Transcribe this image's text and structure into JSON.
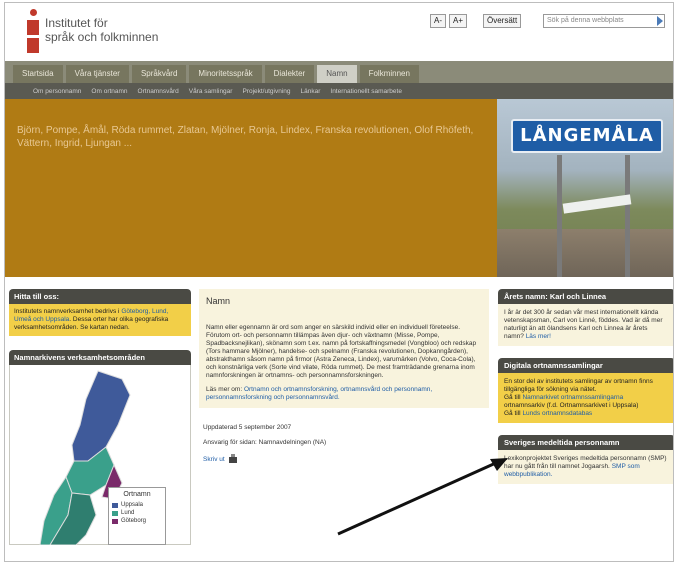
{
  "header": {
    "logo_line1": "Institutet för",
    "logo_line2": "språk och folkminnen",
    "font_smaller": "A-",
    "font_larger": "A+",
    "translate": "Översätt",
    "search_placeholder": "Sök på denna webbplats"
  },
  "main_nav": [
    {
      "label": "Startsida"
    },
    {
      "label": "Våra tjänster"
    },
    {
      "label": "Språkvård"
    },
    {
      "label": "Minoritetsspråk"
    },
    {
      "label": "Dialekter"
    },
    {
      "label": "Namn",
      "active": true
    },
    {
      "label": "Folkminnen"
    }
  ],
  "sub_nav": [
    {
      "label": "Om personnamn"
    },
    {
      "label": "Om ortnamn"
    },
    {
      "label": "Ortnamnsvård"
    },
    {
      "label": "Våra samlingar"
    },
    {
      "label": "Projekt/utgivning"
    },
    {
      "label": "Länkar"
    },
    {
      "label": "Internationellt samarbete"
    }
  ],
  "banner": {
    "text": "Björn, Pompe, Åmål, Röda rummet, Zlatan, Mjölner, Ronja, Lindex, Franska revolutionen, Olof Rhöfeth, Vättern, Ingrid, Ljungan ...",
    "sign_text": "LÅNGEMÅLA"
  },
  "left": {
    "find_title": "Hitta till oss:",
    "find_text": "Institutets namnverksamhet bedrivs i",
    "find_links": "Göteborg, Lund, Umeå och Uppsala",
    "find_text2": ". Dessa orter har olika geografiska verksamhetsområden. Se kartan nedan.",
    "map_title": "Namnarkivens verksamhetsområden",
    "legend_title": "Ortnamn",
    "legend": [
      {
        "label": "Uppsala",
        "color": "#3f5a9a"
      },
      {
        "label": "Lund",
        "color": "#3aa08b"
      },
      {
        "label": "Göteborg",
        "color": "#7a2a6a"
      }
    ]
  },
  "center": {
    "title": "Namn",
    "text": "Namn eller egennamn är ord som anger en särskild individ eller en individuell företeelse. Förutom ort- och personnamn tillämpas även djur- och växtnamn (Misse, Pompe, Spadbacksnejlikan), skönamn som t.ex. namn på fortskaffningsmedel (Vongbloo) och redskap (Tors hammare Mjölner), handelse- och spelnamn (Franska revolutionen, Dopkanngården), abstrakthamn såsom namn på firmor (Astra Zeneca, Lindex), varumärken (Volvo, Coca-Cola), och konstnärliga verk (Sorte vind vilate, Röda rummet). De mest framträdande grenarna inom namnforskningen är ortnamns- och personnamnsforskningen.",
    "read_more_prefix": "Läs mer om:",
    "read_more_links": "Ortnamn och ortnamnsforskning, ortnamnsvård och personnamn, personnamnsforskning och personnamnsvård.",
    "updated": "Uppdaterad 5 september 2007",
    "responsible": "Ansvarig för sidan: Namnavdelningen (NA)",
    "print": "Skriv ut"
  },
  "right": {
    "panel1_title": "Årets namn: Karl och Linnea",
    "panel1_text": "I år är det 300 år sedan vår mest internationellt kända vetenskapsman, Carl von Linné, föddes. Vad är då mer naturligt än att ölandsens Karl och Linnea är årets namn?",
    "panel1_link": "Läs mer!",
    "panel2_title": "Digitala ortnamnssamlingar",
    "panel2_text": "En stor del av institutets samlingar av ortnamn finns tillgängliga för sökning via nätet.",
    "panel2_line1_prefix": "Gå till",
    "panel2_line1_link": "Namnarkivet",
    "panel2_line1_suffix": "ortnamnssamlingarna",
    "panel2_line2": "ortnamnsarkiv (f.d. Ortnamnsarkivet i Uppsala)",
    "panel2_line3_prefix": "Gå till",
    "panel2_line3_link": "Lunds ortnamnsdatabas",
    "panel3_title": "Sveriges medeltida personnamn",
    "panel3_text": "Lexikonprojektet Sveriges medeltida personnamn (SMP) har nu gått från till namnet Jogaarsh.",
    "panel3_link": "SMP som webbpublikation."
  }
}
